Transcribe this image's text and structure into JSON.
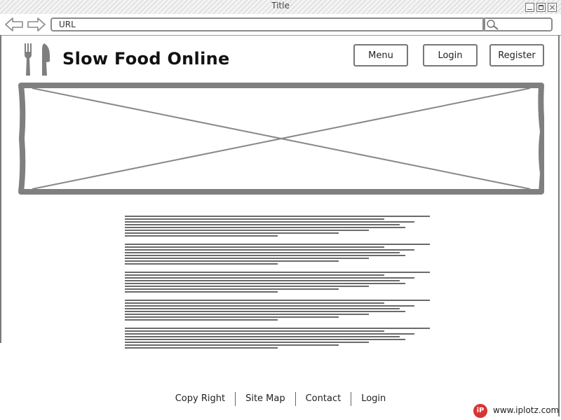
{
  "window": {
    "title": "Title"
  },
  "browser": {
    "url_placeholder": "URL",
    "search_value": ""
  },
  "site": {
    "title": "Slow Food Online"
  },
  "nav": {
    "menu": "Menu",
    "login": "Login",
    "register": "Register"
  },
  "footer": {
    "links": [
      "Copy Right",
      "Site Map",
      "Contact",
      "Login"
    ]
  },
  "watermark": {
    "logo": "iP",
    "text": "www.iplotz.com"
  },
  "colors": {
    "sketch_gray": "#7a7a7a",
    "badge_red": "#d93434"
  }
}
